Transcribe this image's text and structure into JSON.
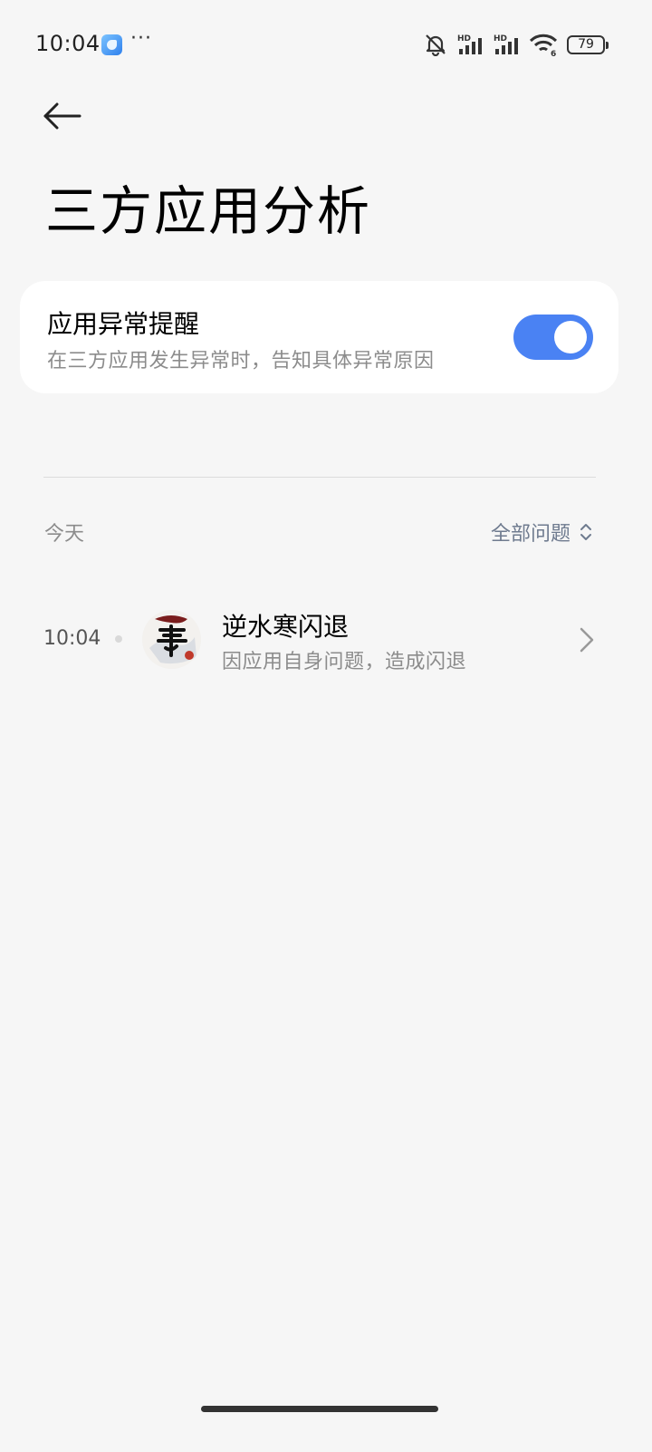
{
  "status_bar": {
    "time": "10:04",
    "app_notification_icon": "browser-app-icon",
    "more_indicator": "···",
    "icons": [
      "muted-bell-icon",
      "signal-hd-icon",
      "signal-hd-icon",
      "wifi-icon"
    ],
    "hd_label": "HD",
    "wifi_badge": "6",
    "battery_level": "79"
  },
  "header": {
    "back_icon": "arrow-left-icon",
    "title": "三方应用分析"
  },
  "settings_card": {
    "title": "应用异常提醒",
    "description": "在三方应用发生异常时，告知具体异常原因",
    "toggle_on": true,
    "toggle_color": "#4a82f3"
  },
  "section": {
    "label": "今天",
    "filter_label": "全部问题",
    "filter_icon": "sort-updown-icon"
  },
  "events": [
    {
      "time": "10:04",
      "app_icon": "nishuihan-app-icon",
      "title": "逆水寒闪退",
      "subtitle": "因应用自身问题，造成闪退",
      "chevron_icon": "chevron-right-icon"
    }
  ]
}
